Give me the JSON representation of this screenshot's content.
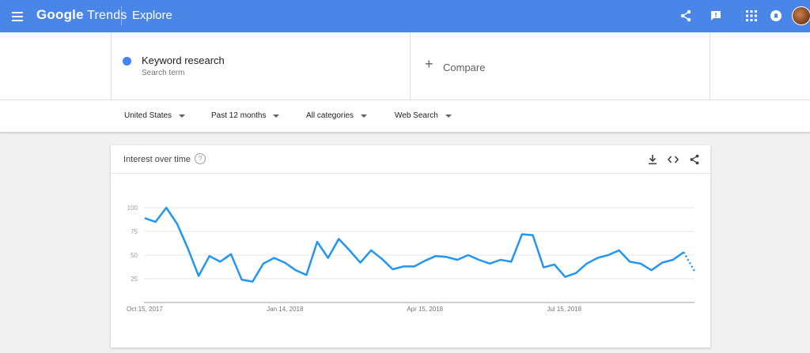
{
  "app": {
    "logo_primary": "Google",
    "logo_secondary": "Trends",
    "section": "Explore"
  },
  "icons": {
    "menu": "menu-icon",
    "share": "share-icon",
    "feedback": "feedback-icon",
    "apps": "apps-grid-icon",
    "notifications": "notifications-icon",
    "avatar": "account-avatar"
  },
  "search": {
    "term": "Keyword research",
    "term_type": "Search term",
    "term_color": "#4285f4",
    "compare_label": "Compare"
  },
  "filters": [
    {
      "label": "United States"
    },
    {
      "label": "Past 12 months"
    },
    {
      "label": "All categories"
    },
    {
      "label": "Web Search"
    }
  ],
  "card": {
    "title": "Interest over time",
    "help": "?"
  },
  "colors": {
    "header": "#4a86e8",
    "series": "#2196f3",
    "gridline": "#e6e6e6"
  },
  "chart_data": {
    "type": "line",
    "title": "Interest over time",
    "ylim": [
      0,
      100
    ],
    "yticks": [
      25,
      50,
      75,
      100
    ],
    "xtick_labels": [
      "Oct 15, 2017",
      "Jan 14, 2018",
      "Apr 15, 2018",
      "Jul 15, 2018"
    ],
    "xtick_index": [
      0,
      13,
      26,
      39
    ],
    "grid": true,
    "partial_last_point": true,
    "series": [
      {
        "name": "Keyword research",
        "values": [
          89,
          85,
          100,
          83,
          57,
          28,
          49,
          43,
          51,
          24,
          22,
          41,
          47,
          42,
          34,
          29,
          64,
          47,
          67,
          55,
          42,
          55,
          46,
          35,
          38,
          38,
          44,
          49,
          48,
          45,
          50,
          45,
          41,
          45,
          43,
          72,
          71,
          37,
          40,
          27,
          31,
          41,
          47,
          50,
          55,
          43,
          41,
          34,
          42,
          45,
          53,
          33
        ]
      }
    ]
  }
}
